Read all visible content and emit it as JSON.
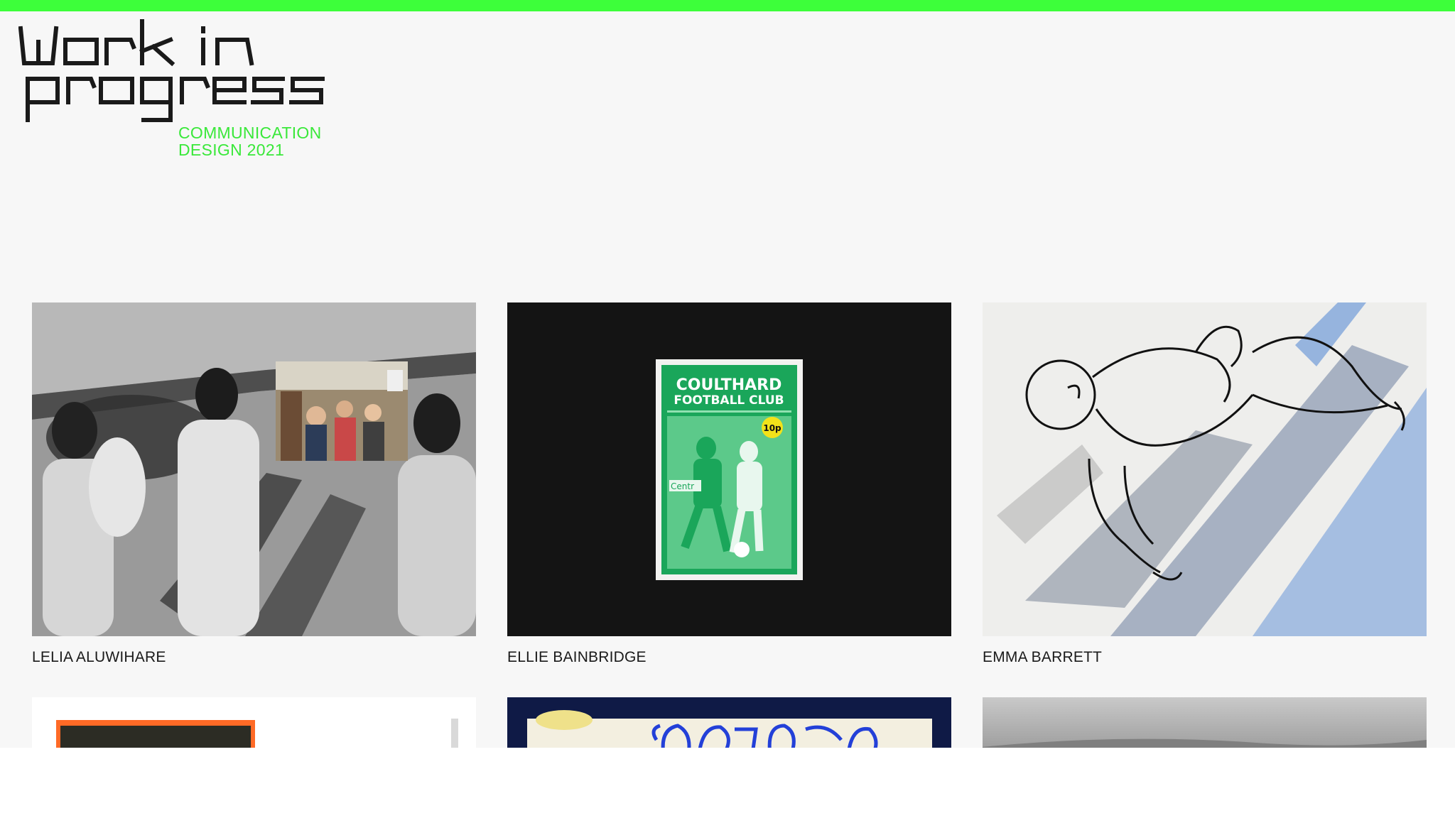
{
  "site": {
    "logo_text_line1": "work in",
    "logo_text_line2": "progress",
    "subtitle_line1": "COMMUNICATION",
    "subtitle_line2": "DESIGN 2021",
    "accent_color": "#3dff3a",
    "subtitle_color": "#3ae83a"
  },
  "students": [
    {
      "name": "LELIA ALUWIHARE"
    },
    {
      "name": "ELLIE BAINBRIDGE"
    },
    {
      "name": "EMMA BARRETT"
    },
    {
      "name": ""
    },
    {
      "name": ""
    },
    {
      "name": ""
    }
  ],
  "poster": {
    "title_line1": "COULTHARD",
    "title_line2": "FOOTBALL CLUB",
    "price": "10p",
    "banner": "Centr"
  }
}
